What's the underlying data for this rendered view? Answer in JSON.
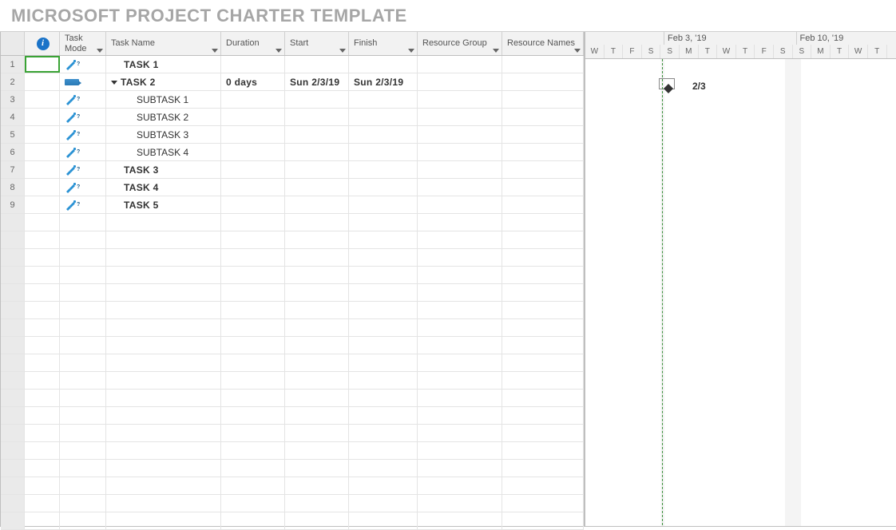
{
  "title": "MICROSOFT PROJECT CHARTER TEMPLATE",
  "columns": {
    "info": "",
    "mode": "Task Mode",
    "name": "Task Name",
    "duration": "Duration",
    "start": "Start",
    "finish": "Finish",
    "rgroup": "Resource Group",
    "rnames": "Resource Names"
  },
  "rows": [
    {
      "n": "1",
      "mode": "manual",
      "indent": 1,
      "bold": true,
      "name": "TASK 1",
      "duration": "",
      "start": "",
      "finish": ""
    },
    {
      "n": "2",
      "mode": "auto",
      "indent": 0,
      "bold": true,
      "expand": true,
      "name": "TASK 2",
      "duration": "0 days",
      "start": "Sun 2/3/19",
      "finish": "Sun 2/3/19"
    },
    {
      "n": "3",
      "mode": "manual",
      "indent": 2,
      "bold": false,
      "name": "SUBTASK 1",
      "duration": "",
      "start": "",
      "finish": ""
    },
    {
      "n": "4",
      "mode": "manual",
      "indent": 2,
      "bold": false,
      "name": "SUBTASK 2",
      "duration": "",
      "start": "",
      "finish": ""
    },
    {
      "n": "5",
      "mode": "manual",
      "indent": 2,
      "bold": false,
      "name": "SUBTASK 3",
      "duration": "",
      "start": "",
      "finish": ""
    },
    {
      "n": "6",
      "mode": "manual",
      "indent": 2,
      "bold": false,
      "name": "SUBTASK 4",
      "duration": "",
      "start": "",
      "finish": ""
    },
    {
      "n": "7",
      "mode": "manual",
      "indent": 1,
      "bold": true,
      "name": "TASK 3",
      "duration": "",
      "start": "",
      "finish": ""
    },
    {
      "n": "8",
      "mode": "manual",
      "indent": 1,
      "bold": true,
      "name": "TASK 4",
      "duration": "",
      "start": "",
      "finish": ""
    },
    {
      "n": "9",
      "mode": "manual",
      "indent": 1,
      "bold": true,
      "name": "TASK 5",
      "duration": "",
      "start": "",
      "finish": ""
    }
  ],
  "empty_rows": 18,
  "timeline": {
    "weeks": [
      "",
      "Feb 3, '19",
      "Feb 10, '19"
    ],
    "week_offsets": [
      0,
      99,
      264.5
    ],
    "days": [
      "W",
      "T",
      "F",
      "S",
      "S",
      "M",
      "T",
      "W",
      "T",
      "F",
      "S",
      "S",
      "M",
      "T",
      "W",
      "T"
    ],
    "milestone_label": "2/3"
  }
}
